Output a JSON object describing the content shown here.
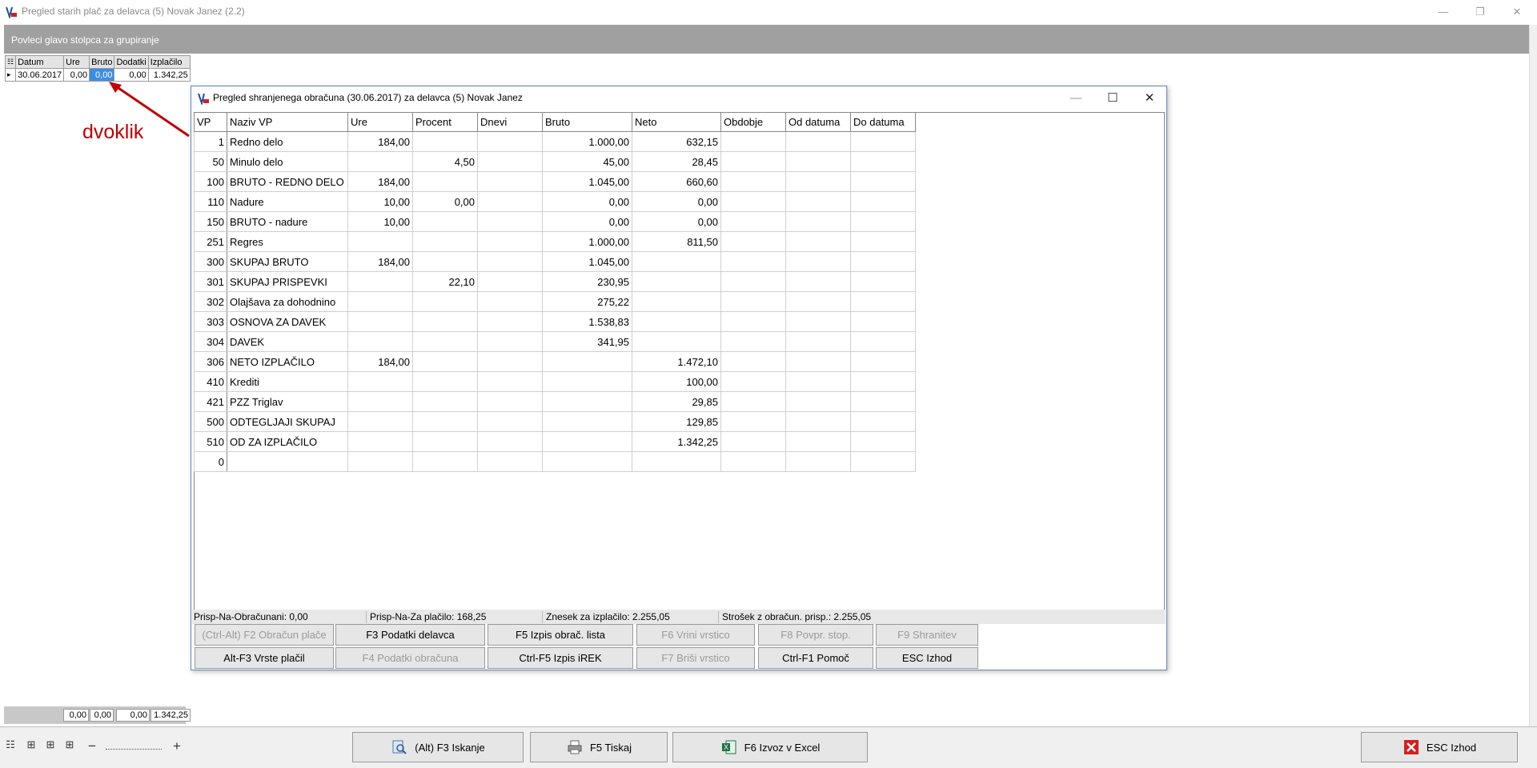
{
  "window": {
    "title": "Pregled starih plač za delavca (5) Novak Janez  (2.2)",
    "min": "—",
    "restore": "❐",
    "close": "✕"
  },
  "group_hint": "Povleci glavo stolpca za grupiranje",
  "small_grid": {
    "headers": [
      "Datum",
      "Ure",
      "Bruto",
      "Dodatki",
      "Izplačilo"
    ],
    "row": {
      "indicator": "▸",
      "datum": "30.06.2017",
      "ure": "0,00",
      "bruto": "0,00",
      "dodatki": "0,00",
      "izplacilo": "1.342,25"
    }
  },
  "annotation": {
    "text": "dvoklik",
    "color": "#c00000"
  },
  "sums": [
    "0,00",
    "0,00",
    "0,00",
    "1.342,25"
  ],
  "toolbar": {
    "buttons": [
      {
        "label": "(Alt) F3 Iskanje",
        "icon": "search-icon"
      },
      {
        "label": "F5 Tiskaj",
        "icon": "printer-icon"
      },
      {
        "label": "F6 Izvoz v Excel",
        "icon": "excel-icon"
      },
      {
        "label": "ESC Izhod",
        "icon": "close-icon"
      }
    ],
    "zoom_minus": "−",
    "zoom_plus": "+"
  },
  "dialog": {
    "title": "Pregled shranjenega obračuna (30.06.2017) za delavca (5) Novak Janez",
    "min": "—",
    "max": "☐",
    "close": "✕",
    "columns": [
      "VP",
      "Naziv VP",
      "Ure",
      "Procent",
      "Dnevi",
      "Bruto",
      "Neto",
      "Obdobje",
      "Od datuma",
      "Do datuma"
    ],
    "rows": [
      [
        "1",
        "Redno delo",
        "184,00",
        "",
        "",
        "1.000,00",
        "632,15",
        "",
        "",
        ""
      ],
      [
        "50",
        "Minulo delo",
        "",
        "4,50",
        "",
        "45,00",
        "28,45",
        "",
        "",
        ""
      ],
      [
        "100",
        "BRUTO - REDNO DELO",
        "184,00",
        "",
        "",
        "1.045,00",
        "660,60",
        "",
        "",
        ""
      ],
      [
        "110",
        "Nadure",
        "10,00",
        "0,00",
        "",
        "0,00",
        "0,00",
        "",
        "",
        ""
      ],
      [
        "150",
        "BRUTO - nadure",
        "10,00",
        "",
        "",
        "0,00",
        "0,00",
        "",
        "",
        ""
      ],
      [
        "251",
        "Regres",
        "",
        "",
        "",
        "1.000,00",
        "811,50",
        "",
        "",
        ""
      ],
      [
        "300",
        "SKUPAJ BRUTO",
        "184,00",
        "",
        "",
        "1.045,00",
        "",
        "",
        "",
        ""
      ],
      [
        "301",
        "SKUPAJ PRISPEVKI",
        "",
        "22,10",
        "",
        "230,95",
        "",
        "",
        "",
        ""
      ],
      [
        "302",
        "Olajšava za dohodnino",
        "",
        "",
        "",
        "275,22",
        "",
        "",
        "",
        ""
      ],
      [
        "303",
        "OSNOVA ZA DAVEK",
        "",
        "",
        "",
        "1.538,83",
        "",
        "",
        "",
        ""
      ],
      [
        "304",
        "DAVEK",
        "",
        "",
        "",
        "341,95",
        "",
        "",
        "",
        ""
      ],
      [
        "306",
        "NETO IZPLAČILO",
        "184,00",
        "",
        "",
        "",
        "1.472,10",
        "",
        "",
        ""
      ],
      [
        "410",
        "Krediti",
        "",
        "",
        "",
        "",
        "100,00",
        "",
        "",
        ""
      ],
      [
        "421",
        "PZZ Triglav",
        "",
        "",
        "",
        "",
        "29,85",
        "",
        "",
        ""
      ],
      [
        "500",
        "ODTEGLJAJI SKUPAJ",
        "",
        "",
        "",
        "",
        "129,85",
        "",
        "",
        ""
      ],
      [
        "510",
        "OD ZA IZPLAČILO",
        "",
        "",
        "",
        "",
        "1.342,25",
        "",
        "",
        ""
      ],
      [
        "0",
        "",
        "",
        "",
        "",
        "",
        "",
        "",
        "",
        ""
      ]
    ],
    "status": [
      "Prisp-Na-Obračunani: 0,00",
      "Prisp-Na-Za plačilo: 168,25",
      "Znesek za izplačilo: 2.255,05",
      "Strošek z obračun. prisp.: 2.255,05"
    ],
    "buttons_row1": [
      {
        "label": "(Ctrl-Alt) F2  Obračun plače",
        "enabled": false
      },
      {
        "label": "F3 Podatki delavca",
        "enabled": true
      },
      {
        "label": "F5 Izpis obrač. lista",
        "enabled": true
      },
      {
        "label": "F6 Vrini vrstico",
        "enabled": false
      },
      {
        "label": "F8  Povpr. stop.",
        "enabled": false
      },
      {
        "label": "F9  Shranitev",
        "enabled": false
      }
    ],
    "buttons_row2": [
      {
        "label": "Alt-F3 Vrste plačil",
        "enabled": true
      },
      {
        "label": "F4  Podatki obračuna",
        "enabled": false
      },
      {
        "label": "Ctrl-F5  Izpis iREK",
        "enabled": true
      },
      {
        "label": "F7 Briši vrstico",
        "enabled": false
      },
      {
        "label": "Ctrl-F1  Pomoč",
        "enabled": true
      },
      {
        "label": "ESC  Izhod",
        "enabled": true
      }
    ]
  }
}
